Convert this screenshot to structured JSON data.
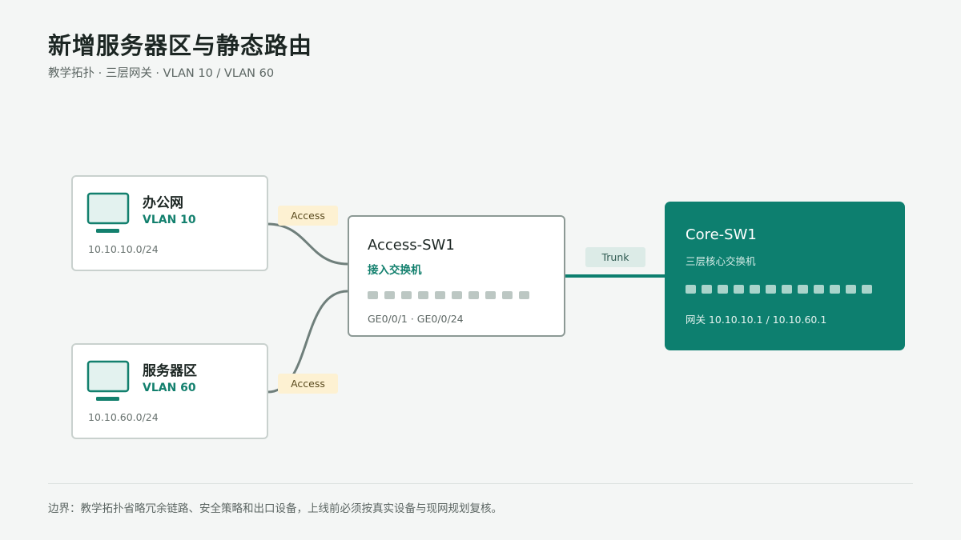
{
  "header": {
    "title": "新增服务器区与静态路由",
    "subtitle": "教学拓扑 · 三层网关 · VLAN 10 / VLAN 60"
  },
  "nodes": {
    "office": {
      "name": "办公网",
      "vlan": "VLAN 10",
      "subnet": "10.10.10.0/24"
    },
    "server": {
      "name": "服务器区",
      "vlan": "VLAN 60",
      "subnet": "10.10.60.0/24"
    },
    "access_sw": {
      "name": "Access-SW1",
      "role": "接入交换机",
      "ports": "GE0/0/1 · GE0/0/24",
      "port_count": 10
    },
    "core_sw": {
      "name": "Core-SW1",
      "role": "三层核心交换机",
      "gateway": "网关 10.10.10.1 / 10.10.60.1",
      "port_count": 12
    }
  },
  "links": {
    "office_access": "Access",
    "server_access": "Access",
    "trunk": "Trunk"
  },
  "colors": {
    "accent": "#0d7f6f",
    "link": "#6f7f7b",
    "access_tag": "#fdf1d2",
    "trunk_tag": "#dcebe7"
  },
  "footer": {
    "note": "边界：教学拓扑省略冗余链路、安全策略和出口设备，上线前必须按真实设备与现网规划复核。"
  }
}
